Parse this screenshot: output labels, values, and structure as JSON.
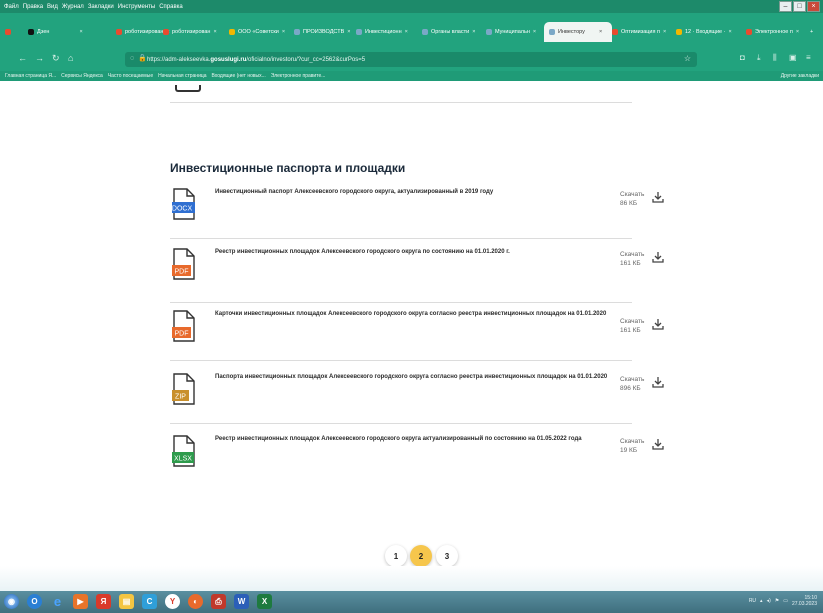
{
  "menubar": {
    "items": [
      "Файл",
      "Правка",
      "Вид",
      "Журнал",
      "Закладки",
      "Инструменты",
      "Справка"
    ]
  },
  "tabs": [
    {
      "label": "Дзен",
      "fav": "#111111"
    },
    {
      "label": "роботизирован",
      "fav": "#e84b2f"
    },
    {
      "label": "роботизирован",
      "fav": "#e84b2f"
    },
    {
      "label": "ООО «Советски",
      "fav": "#f2b700"
    },
    {
      "label": "ПРОИЗВОДСТВ",
      "fav": "#7aa8c7"
    },
    {
      "label": "Инвестиционн",
      "fav": "#7aa8c7"
    },
    {
      "label": "Органы власти",
      "fav": "#7aa8c7"
    },
    {
      "label": "Муниципальн",
      "fav": "#7aa8c7"
    },
    {
      "label": "Инвестору",
      "fav": "#7aa8c7",
      "active": true
    },
    {
      "label": "Оптимизация п",
      "fav": "#e84b2f"
    },
    {
      "label": "12 · Входящие ·",
      "fav": "#f2b700"
    },
    {
      "label": "Электронное п",
      "fav": "#e84b2f"
    }
  ],
  "address": {
    "prefix": "https://adm-alekseevka.",
    "domain": "gosuslugi.ru",
    "suffix": "/oficialno/investoru/?cur_cc=2562&curPos=5"
  },
  "bookmarks": {
    "items": [
      "Главная страница Я...",
      "Сервисы Яндекса",
      "Часто посещаемые",
      "Начальная страница",
      "Входящие (нет новых...",
      "Электронное правите..."
    ],
    "other": "Другие закладки"
  },
  "section": {
    "title": "Инвестиционные паспорта и площадки"
  },
  "documents": [
    {
      "title": "Инвестиционный паспорт Алексеевского городского округа, актуализированный в 2019 году",
      "type": "DOCX",
      "type_color": "#2f6fd1",
      "download_label": "Скачать",
      "size": "86 КБ"
    },
    {
      "title": "Реестр инвестиционных площадок Алексеевского городского округа по состоянию на 01.01.2020 г.",
      "type": "PDF",
      "type_color": "#e86a2c",
      "download_label": "Скачать",
      "size": "161 КБ"
    },
    {
      "title": "Карточки инвестиционных площадок Алексеевского городского округа согласно реестра инвестиционных площадок на 01.01.2020",
      "type": "PDF",
      "type_color": "#e86a2c",
      "download_label": "Скачать",
      "size": "161 КБ"
    },
    {
      "title": "Паспорта инвестиционных площадок Алексеевского городского округа согласно реестра инвестиционных площадок на 01.01.2020",
      "type": "ZIP",
      "type_color": "#c9902d",
      "download_label": "Скачать",
      "size": "896 КБ"
    },
    {
      "title": "Реестр инвестиционных площадок Алексеевского городского округа актуализированный по состоянию на 01.05.2022 года",
      "type": "XLSX",
      "type_color": "#2e9b4c",
      "download_label": "Скачать",
      "size": "19 КБ"
    }
  ],
  "pagination": {
    "pages": [
      "1",
      "2",
      "3"
    ],
    "current": "2"
  },
  "taskbar": {
    "clock_time": "15:10",
    "clock_date": "27.03.2023",
    "lang": "RU"
  }
}
